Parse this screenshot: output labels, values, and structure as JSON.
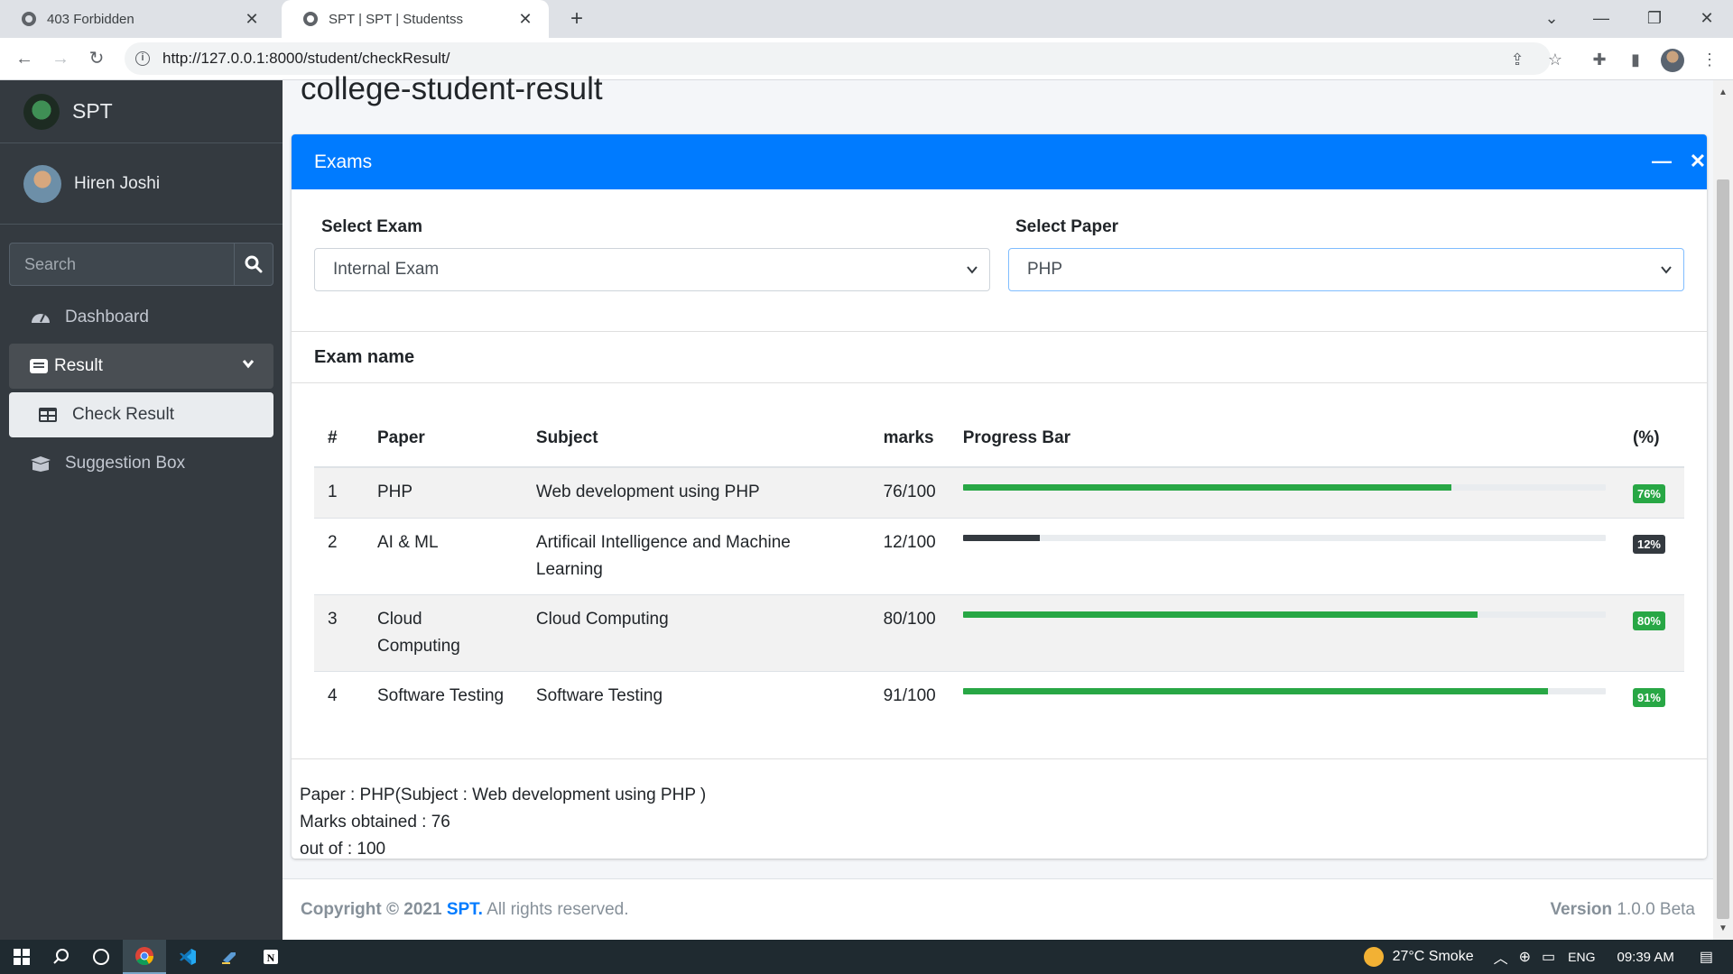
{
  "browser": {
    "tabs": [
      {
        "title": "403 Forbidden",
        "active": false
      },
      {
        "title": "SPT | SPT | Studentss",
        "active": true
      }
    ],
    "url": "http://127.0.0.1:8000/student/checkResult/"
  },
  "sidebar": {
    "brand": "SPT",
    "user_name": "Hiren Joshi",
    "search_placeholder": "Search",
    "items": [
      {
        "label": "Dashboard",
        "icon": "tachometer-icon"
      },
      {
        "label": "Result",
        "icon": "inbox-icon"
      },
      {
        "label": "Check Result",
        "icon": "table-icon"
      },
      {
        "label": "Suggestion Box",
        "icon": "box-icon"
      }
    ]
  },
  "page": {
    "title": "college-student-result",
    "card_title": "Exams",
    "select_exam_label": "Select Exam",
    "select_exam_value": "Internal Exam",
    "select_paper_label": "Select Paper",
    "select_paper_value": "PHP",
    "inner_title": "Exam name"
  },
  "table": {
    "headers": [
      "#",
      "Paper",
      "Subject",
      "marks",
      "Progress Bar",
      "(%)"
    ],
    "rows": [
      {
        "num": "1",
        "paper": "PHP",
        "subject": "Web development using PHP",
        "marks": "76/100",
        "progress": 76,
        "percent": "76%",
        "color": "#28a745"
      },
      {
        "num": "2",
        "paper": "AI & ML",
        "subject": "Artificail Intelligence and Machine Learning",
        "marks": "12/100",
        "progress": 12,
        "percent": "12%",
        "color": "#343a40"
      },
      {
        "num": "3",
        "paper": "Cloud Computing",
        "subject": "Cloud Computing",
        "marks": "80/100",
        "progress": 80,
        "percent": "80%",
        "color": "#28a745"
      },
      {
        "num": "4",
        "paper": "Software Testing",
        "subject": "Software Testing",
        "marks": "91/100",
        "progress": 91,
        "percent": "91%",
        "color": "#28a745"
      }
    ]
  },
  "summary": {
    "paper_line": "Paper : PHP(Subject : Web development using PHP )",
    "marks_line": "Marks obtained : 76",
    "outof_line": "out of : 100"
  },
  "footer": {
    "copyright_prefix": "Copyright © 2021",
    "brand": "SPT.",
    "rights": "All rights reserved.",
    "version_label": "Version",
    "version_value": "1.0.0 Beta"
  },
  "taskbar": {
    "weather": "27°C  Smoke",
    "lang": "ENG",
    "time": "09:39 AM"
  },
  "colors": {
    "primary": "#007bff",
    "sidebar": "#343a40",
    "success": "#28a745",
    "dark": "#343a40"
  }
}
